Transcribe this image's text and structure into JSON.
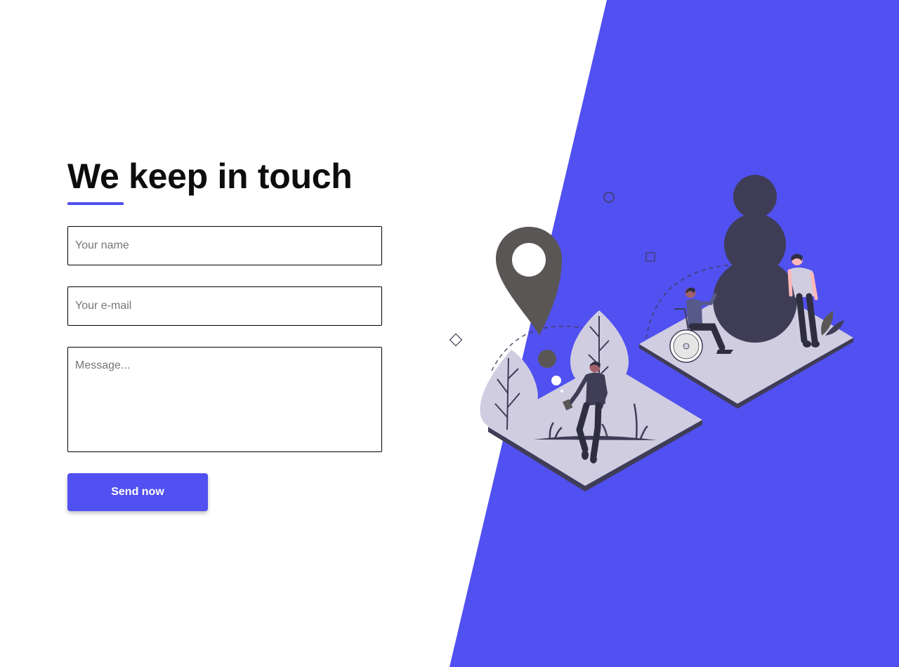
{
  "colors": {
    "accent": "#5150f0",
    "illustration_dark": "#3f3d56",
    "illustration_light": "#d0cde1",
    "pin": "#5a5655"
  },
  "contact": {
    "title": "We keep in touch",
    "name_placeholder": "Your name",
    "email_placeholder": "Your e-mail",
    "message_placeholder": "Message...",
    "send_label": "Send now"
  },
  "illustration": {
    "icons": [
      "location-pin-icon",
      "wheelchair-person",
      "standing-person",
      "walking-person",
      "tree-icon",
      "bush-icon"
    ]
  }
}
